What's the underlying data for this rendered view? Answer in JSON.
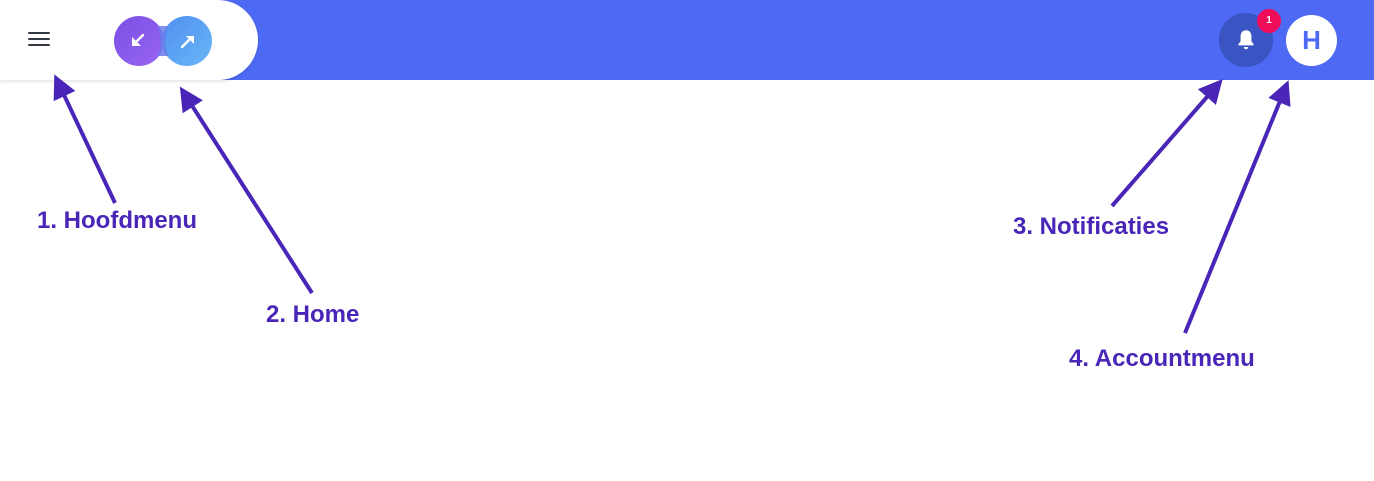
{
  "colors": {
    "topbar": "#4e6af4",
    "annotation": "#4a26b8",
    "badge": "#ef0d5a",
    "bell_bg": "#3a54c4"
  },
  "header": {
    "menu_icon": "hamburger-menu-icon",
    "logo_icon": "infinity-arrows-logo",
    "bell_icon": "bell-icon",
    "notification_count": "1",
    "avatar_initial": "H"
  },
  "annotations": [
    {
      "label": "1. Hoofdmenu"
    },
    {
      "label": "2. Home"
    },
    {
      "label": "3. Notificaties"
    },
    {
      "label": "4. Accountmenu"
    }
  ]
}
